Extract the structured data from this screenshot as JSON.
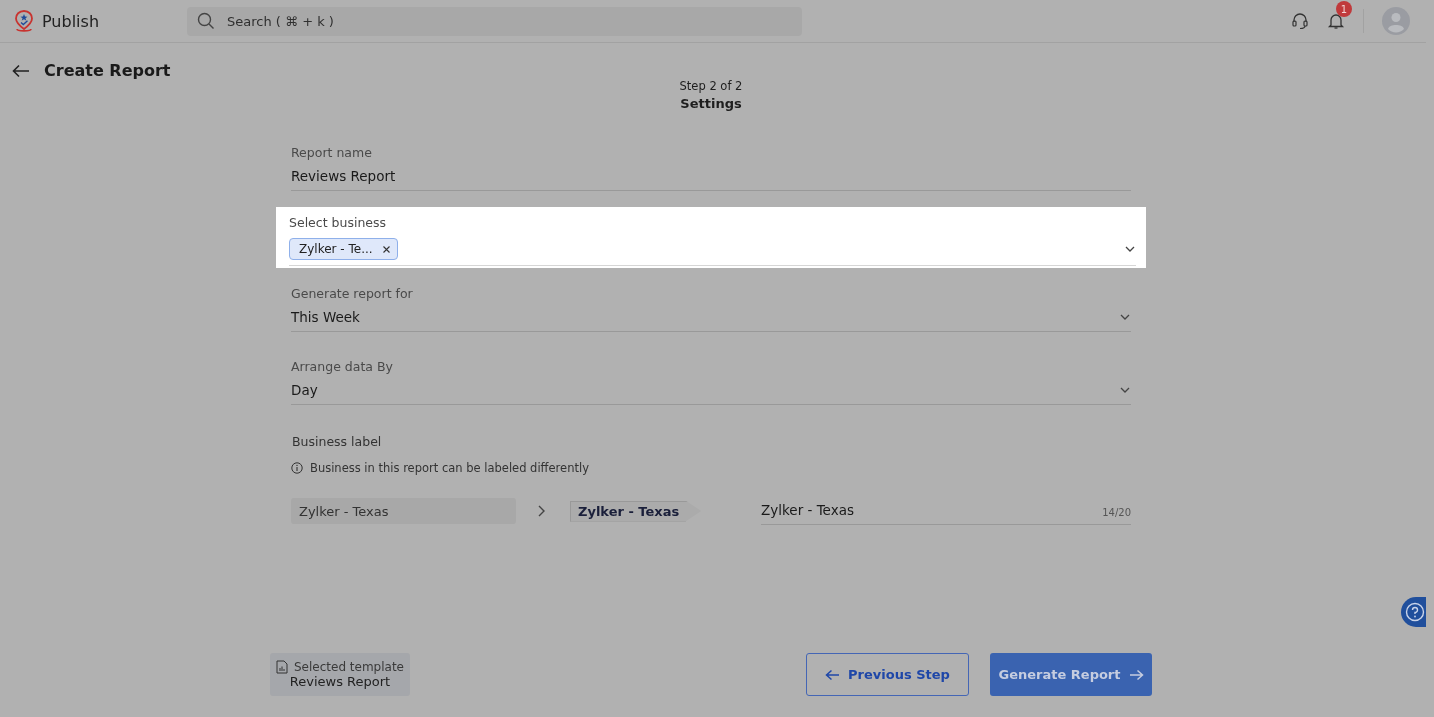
{
  "app": {
    "name": "Publish"
  },
  "search": {
    "placeholder": "Search ( ⌘ + k )"
  },
  "notifications": {
    "count": "1"
  },
  "page": {
    "title": "Create Report",
    "step": "Step 2 of 2",
    "step_title": "Settings"
  },
  "fields": [
    {
      "kind": "text",
      "label": "Report name",
      "value": "Reviews Report",
      "highlighted": false
    },
    {
      "kind": "chips",
      "label": "Select business",
      "chips": [
        "Zylker - Te..."
      ],
      "highlighted": true
    },
    {
      "kind": "dropdown",
      "label": "Generate report for",
      "value": "This Week",
      "highlighted": false
    },
    {
      "kind": "dropdown",
      "label": "Arrange data By",
      "value": "Day",
      "highlighted": false
    }
  ],
  "business_label": {
    "title": "Business label",
    "info": "Business in this report can be labeled differently",
    "original": "Zylker - Texas",
    "tag": "Zylker - Texas",
    "value": "Zylker - Texas",
    "counter": "14/20"
  },
  "template": {
    "caption": "Selected template",
    "name": "Reviews Report"
  },
  "buttons": [
    {
      "kind": "back",
      "label": "Previous Step"
    },
    {
      "kind": "primary",
      "label": "Generate Report"
    }
  ]
}
